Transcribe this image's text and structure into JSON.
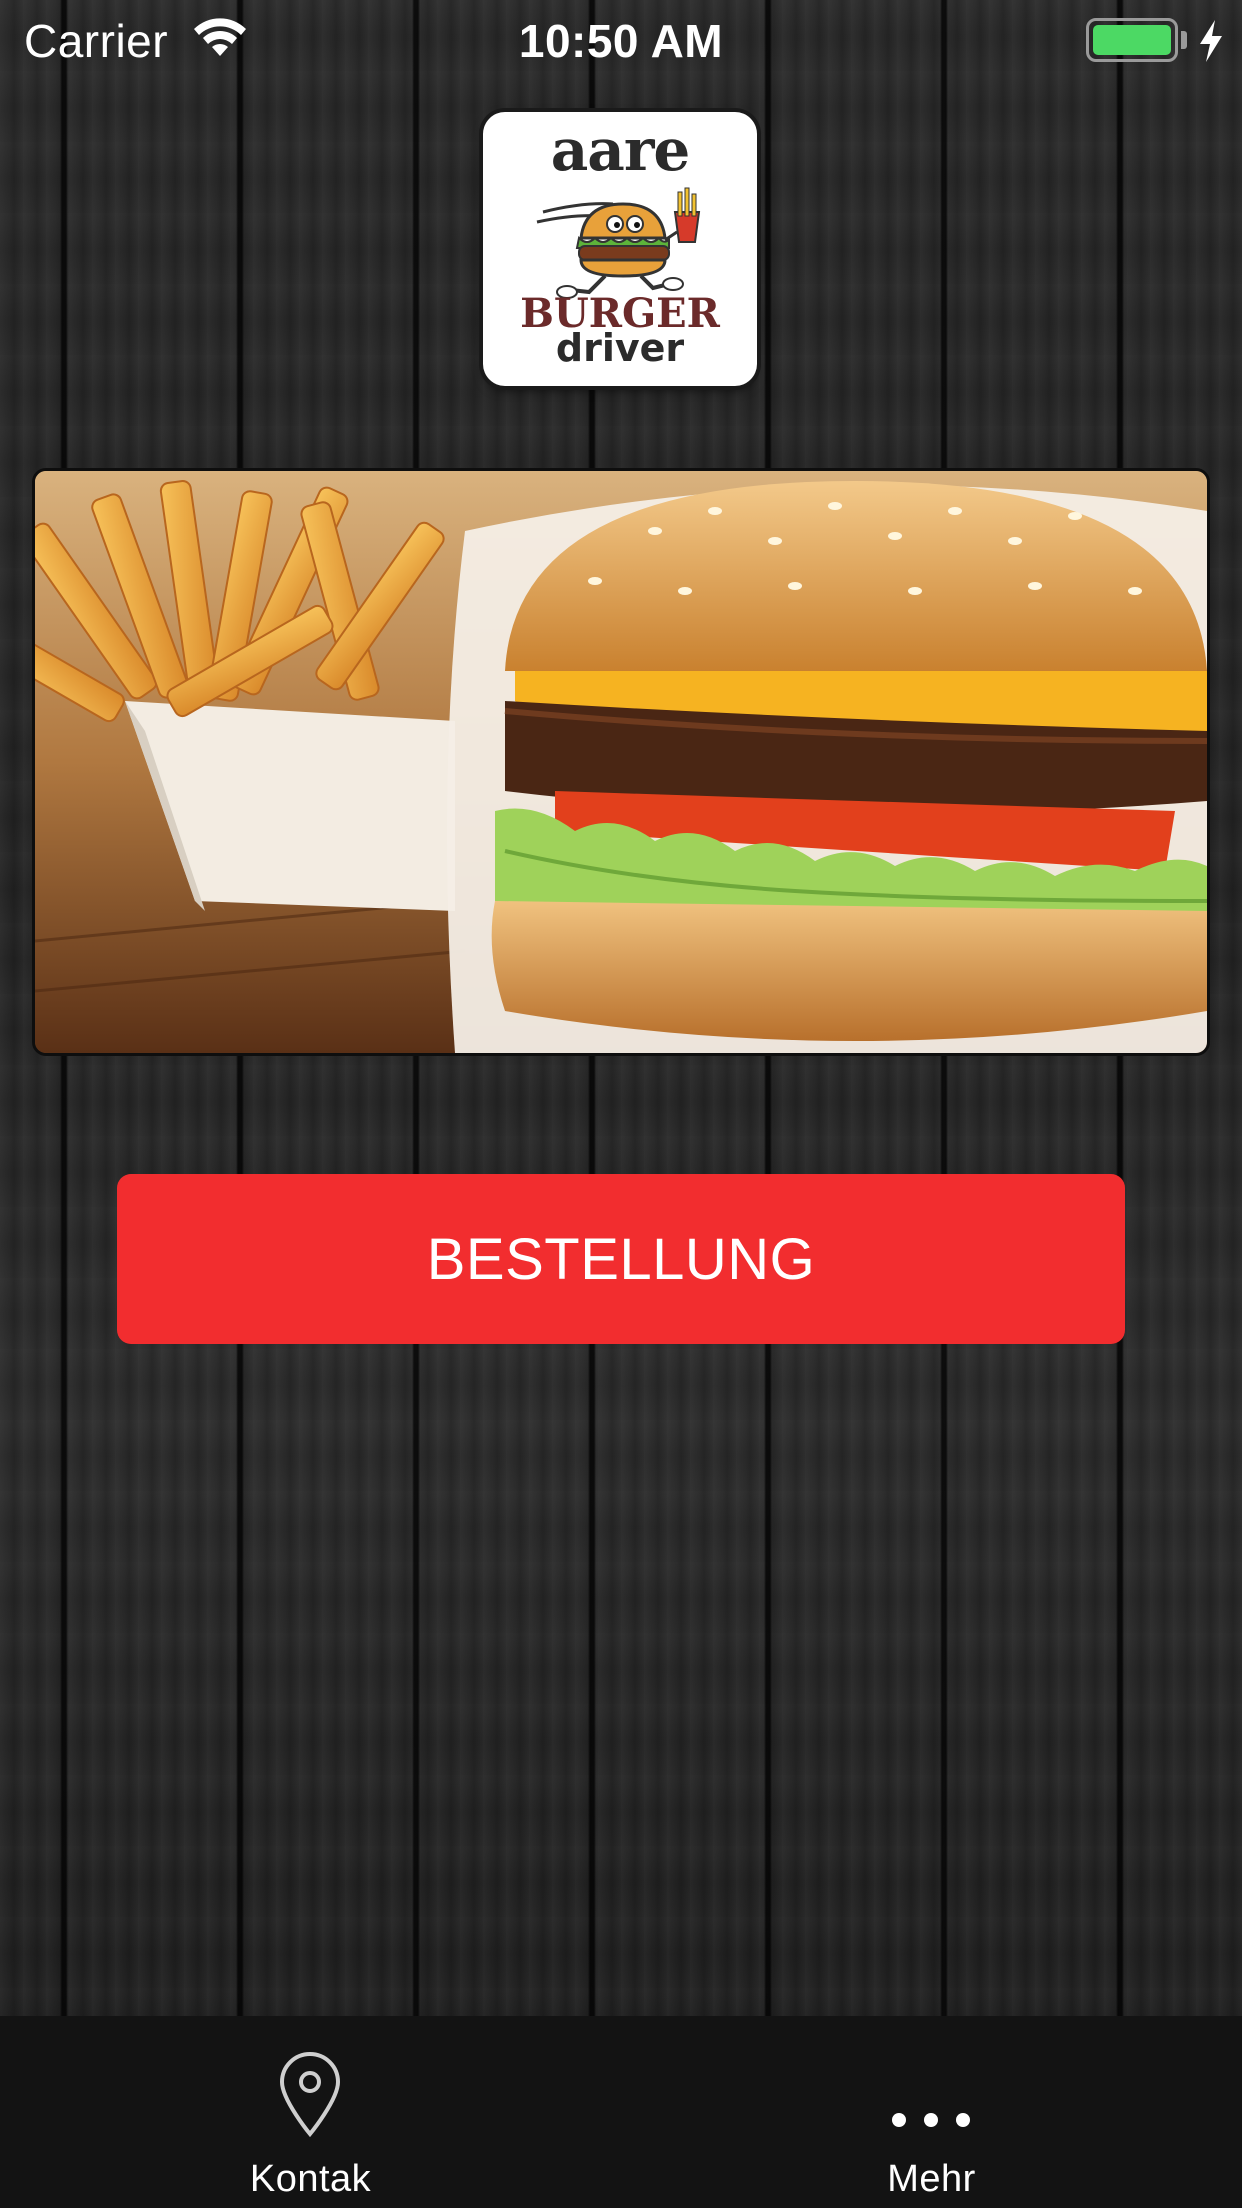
{
  "status_bar": {
    "carrier": "Carrier",
    "time": "10:50 AM",
    "battery_color": "#4cd964"
  },
  "logo": {
    "line1": "aare",
    "line2": "BURGER",
    "line3": "driver"
  },
  "hero": {
    "icon": "burger-fries-photo"
  },
  "order_button": {
    "label": "BESTELLUNG",
    "color": "#f22d2f"
  },
  "tab_bar": {
    "tabs": [
      {
        "label": "Kontak",
        "icon": "location-pin-icon"
      },
      {
        "label": "Mehr",
        "icon": "more-dots-icon"
      }
    ]
  }
}
